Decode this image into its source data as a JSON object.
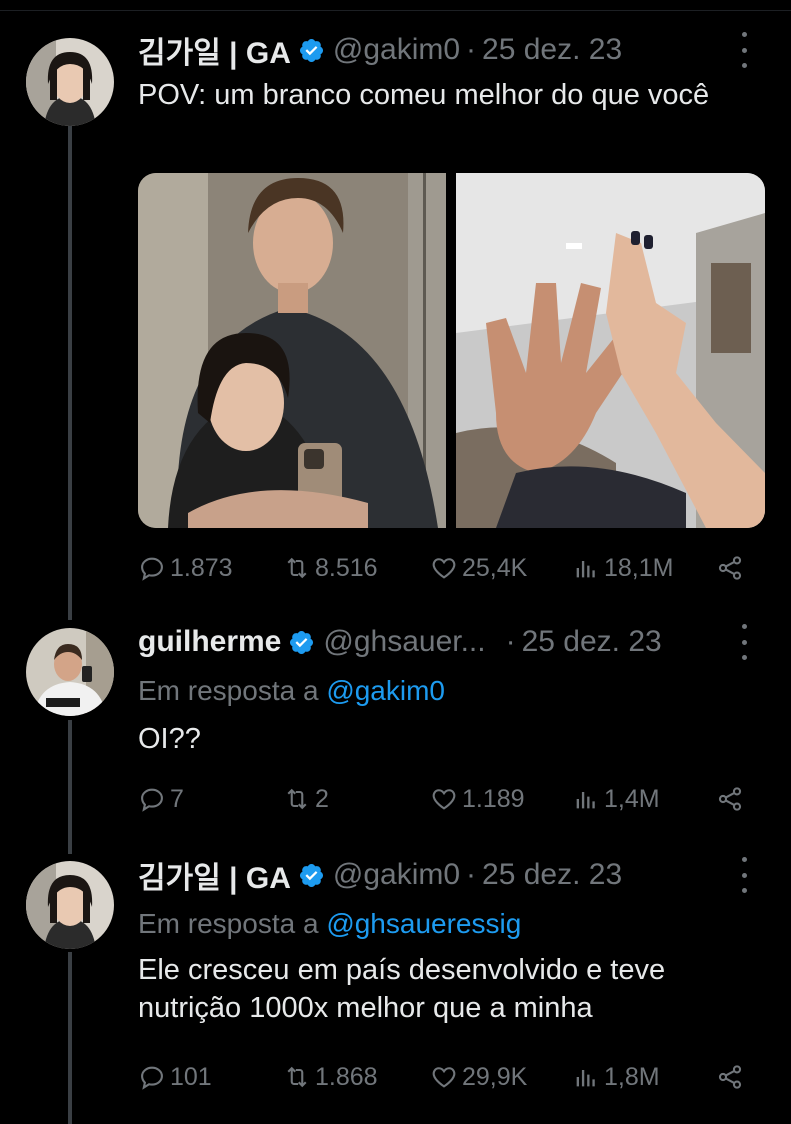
{
  "tweets": [
    {
      "name": "김가일 | GA",
      "handle": "@gakim0",
      "dot": "·",
      "date": "25 dez. 23",
      "text": "POV: um branco comeu melhor do que você",
      "stats": {
        "replies": "1.873",
        "retweets": "8.516",
        "likes": "25,4K",
        "views": "18,1M"
      }
    },
    {
      "name": "guilherme",
      "handle": "@ghsauer...",
      "dot": "·",
      "date": "25 dez. 23",
      "reply_prefix": "Em resposta a",
      "reply_to": "@gakim0",
      "text": "OI??",
      "stats": {
        "replies": "7",
        "retweets": "2",
        "likes": "1.189",
        "views": "1,4M"
      }
    },
    {
      "name": "김가일 | GA",
      "handle": "@gakim0",
      "dot": "·",
      "date": "25 dez. 23",
      "reply_prefix": "Em resposta a",
      "reply_to": "@ghsaueressig",
      "text": "Ele cresceu em país desenvolvido e teve nutrição 1000x melhor que a minha",
      "stats": {
        "replies": "101",
        "retweets": "1.868",
        "likes": "29,9K",
        "views": "1,8M"
      }
    }
  ],
  "colors": {
    "background": "#000000",
    "text": "#e7e9ea",
    "muted": "#71767b",
    "link": "#1d9bf0",
    "verified": "#1d9bf0"
  }
}
